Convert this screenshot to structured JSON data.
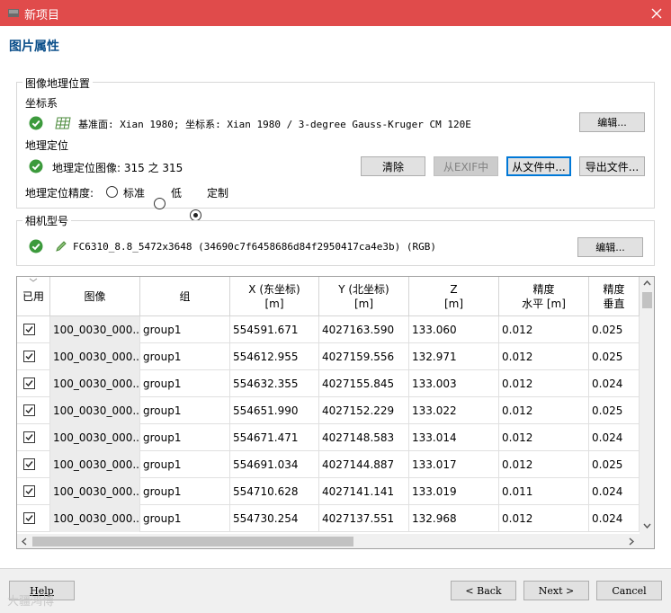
{
  "window": {
    "title": "新项目",
    "close_icon": "close-icon"
  },
  "page_title": "图片属性",
  "geolocation_group": {
    "title": "图像地理位置",
    "coord_system": {
      "heading": "坐标系",
      "text": "基准面: Xian 1980; 坐标系: Xian 1980 / 3-degree Gauss-Kruger CM 120E",
      "edit_label": "编辑..."
    },
    "georef": {
      "heading": "地理定位",
      "text": "地理定位图像: 315 之 315",
      "clear_label": "清除",
      "from_exif_label": "从EXIF中",
      "from_file_label": "从文件中...",
      "export_label": "导出文件..."
    },
    "accuracy": {
      "label": "地理定位精度:",
      "options": [
        "标准",
        "低",
        "定制"
      ],
      "selected": "定制"
    }
  },
  "camera_group": {
    "title": "相机型号",
    "text": "FC6310_8.8_5472x3648 (34690c7f6458686d84f2950417ca4e3b) (RGB)",
    "edit_label": "编辑..."
  },
  "table": {
    "columns": [
      {
        "l1": "已用",
        "l2": ""
      },
      {
        "l1": "图像",
        "l2": ""
      },
      {
        "l1": "组",
        "l2": ""
      },
      {
        "l1": "X (东坐标)",
        "l2": "[m]"
      },
      {
        "l1": "Y (北坐标)",
        "l2": "[m]"
      },
      {
        "l1": "Z",
        "l2": "[m]"
      },
      {
        "l1": "精度",
        "l2": "水平 [m]"
      },
      {
        "l1": "精度",
        "l2": "垂直"
      }
    ],
    "rows": [
      {
        "used": true,
        "image": "100_0030_000...",
        "group": "group1",
        "x": "554591.671",
        "y": "4027163.590",
        "z": "133.060",
        "h": "0.012",
        "v": "0.025"
      },
      {
        "used": true,
        "image": "100_0030_000...",
        "group": "group1",
        "x": "554612.955",
        "y": "4027159.556",
        "z": "132.971",
        "h": "0.012",
        "v": "0.025"
      },
      {
        "used": true,
        "image": "100_0030_000...",
        "group": "group1",
        "x": "554632.355",
        "y": "4027155.845",
        "z": "133.003",
        "h": "0.012",
        "v": "0.024"
      },
      {
        "used": true,
        "image": "100_0030_000...",
        "group": "group1",
        "x": "554651.990",
        "y": "4027152.229",
        "z": "133.022",
        "h": "0.012",
        "v": "0.025"
      },
      {
        "used": true,
        "image": "100_0030_000...",
        "group": "group1",
        "x": "554671.471",
        "y": "4027148.583",
        "z": "133.014",
        "h": "0.012",
        "v": "0.024"
      },
      {
        "used": true,
        "image": "100_0030_000...",
        "group": "group1",
        "x": "554691.034",
        "y": "4027144.887",
        "z": "133.017",
        "h": "0.012",
        "v": "0.025"
      },
      {
        "used": true,
        "image": "100_0030_000...",
        "group": "group1",
        "x": "554710.628",
        "y": "4027141.141",
        "z": "133.019",
        "h": "0.011",
        "v": "0.024"
      },
      {
        "used": true,
        "image": "100_0030_000...",
        "group": "group1",
        "x": "554730.254",
        "y": "4027137.551",
        "z": "132.968",
        "h": "0.012",
        "v": "0.024"
      }
    ]
  },
  "footer": {
    "help_label": "Help",
    "back_label": "< Back",
    "next_label": "Next >",
    "cancel_label": "Cancel"
  },
  "watermark": "大疆鸿博",
  "colors": {
    "titlebar": "#e04b4b",
    "heading": "#0b4f8a",
    "ok_green": "#3c9a3c"
  }
}
